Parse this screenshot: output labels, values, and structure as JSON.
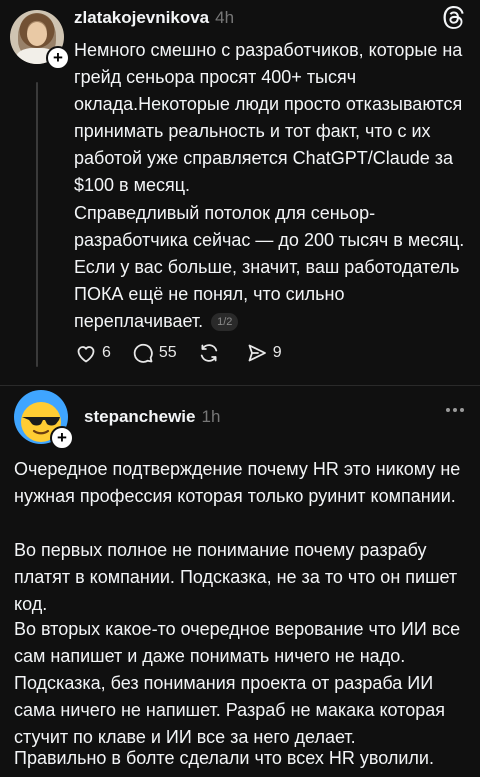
{
  "post1": {
    "username": "zlatakojevnikova",
    "time": "4h",
    "paragraph1": "Немного смешно с разработчиков, которые на грейд сеньора просят 400+ тысяч оклада.Некоторые люди просто отказываются принимать реальность и тот факт, что с их работой уже справляется ChatGPT/Claude за $100 в месяц.",
    "paragraph2": "Справедливый потолок для сеньор-разработчика сейчас — до 200 тысяч в месяц. Если у вас больше, значит, ваш работодатель ПОКА ещё не понял, что сильно переплачивает.",
    "page_indicator": "1/2",
    "likes": "6",
    "replies": "55",
    "shares": "9"
  },
  "post2": {
    "username": "stepanchewie",
    "time": "1h",
    "avatar_emoji": "😎",
    "lines": [
      "Очередное подтверждение почему  HR это никому не нужная профессия которая только руинит компании.",
      "Во первых полное не понимание почему разрабу платят в компании. Подсказка, не за то что он пишет код.",
      "Во вторых какое-то очередное верование что ИИ все сам напишет и даже понимать ничего не надо. Подсказка, без понимания проекта от разраба ИИ сама ничего не напишет. Разраб не макака которая стучит по клаве и ИИ все за него делает.",
      "Правильно в болте сделали что всех HR уволили."
    ]
  },
  "icons": {
    "threads_logo": "threads-logo-icon",
    "like": "heart-icon",
    "reply": "comment-icon",
    "repost": "repost-icon",
    "share": "send-icon",
    "more": "more-horizontal-icon",
    "follow": "plus-icon"
  },
  "colors": {
    "background": "#101010",
    "text": "#f3f5f7",
    "secondary_text": "#777777",
    "thread_line": "#3a3a3a"
  }
}
